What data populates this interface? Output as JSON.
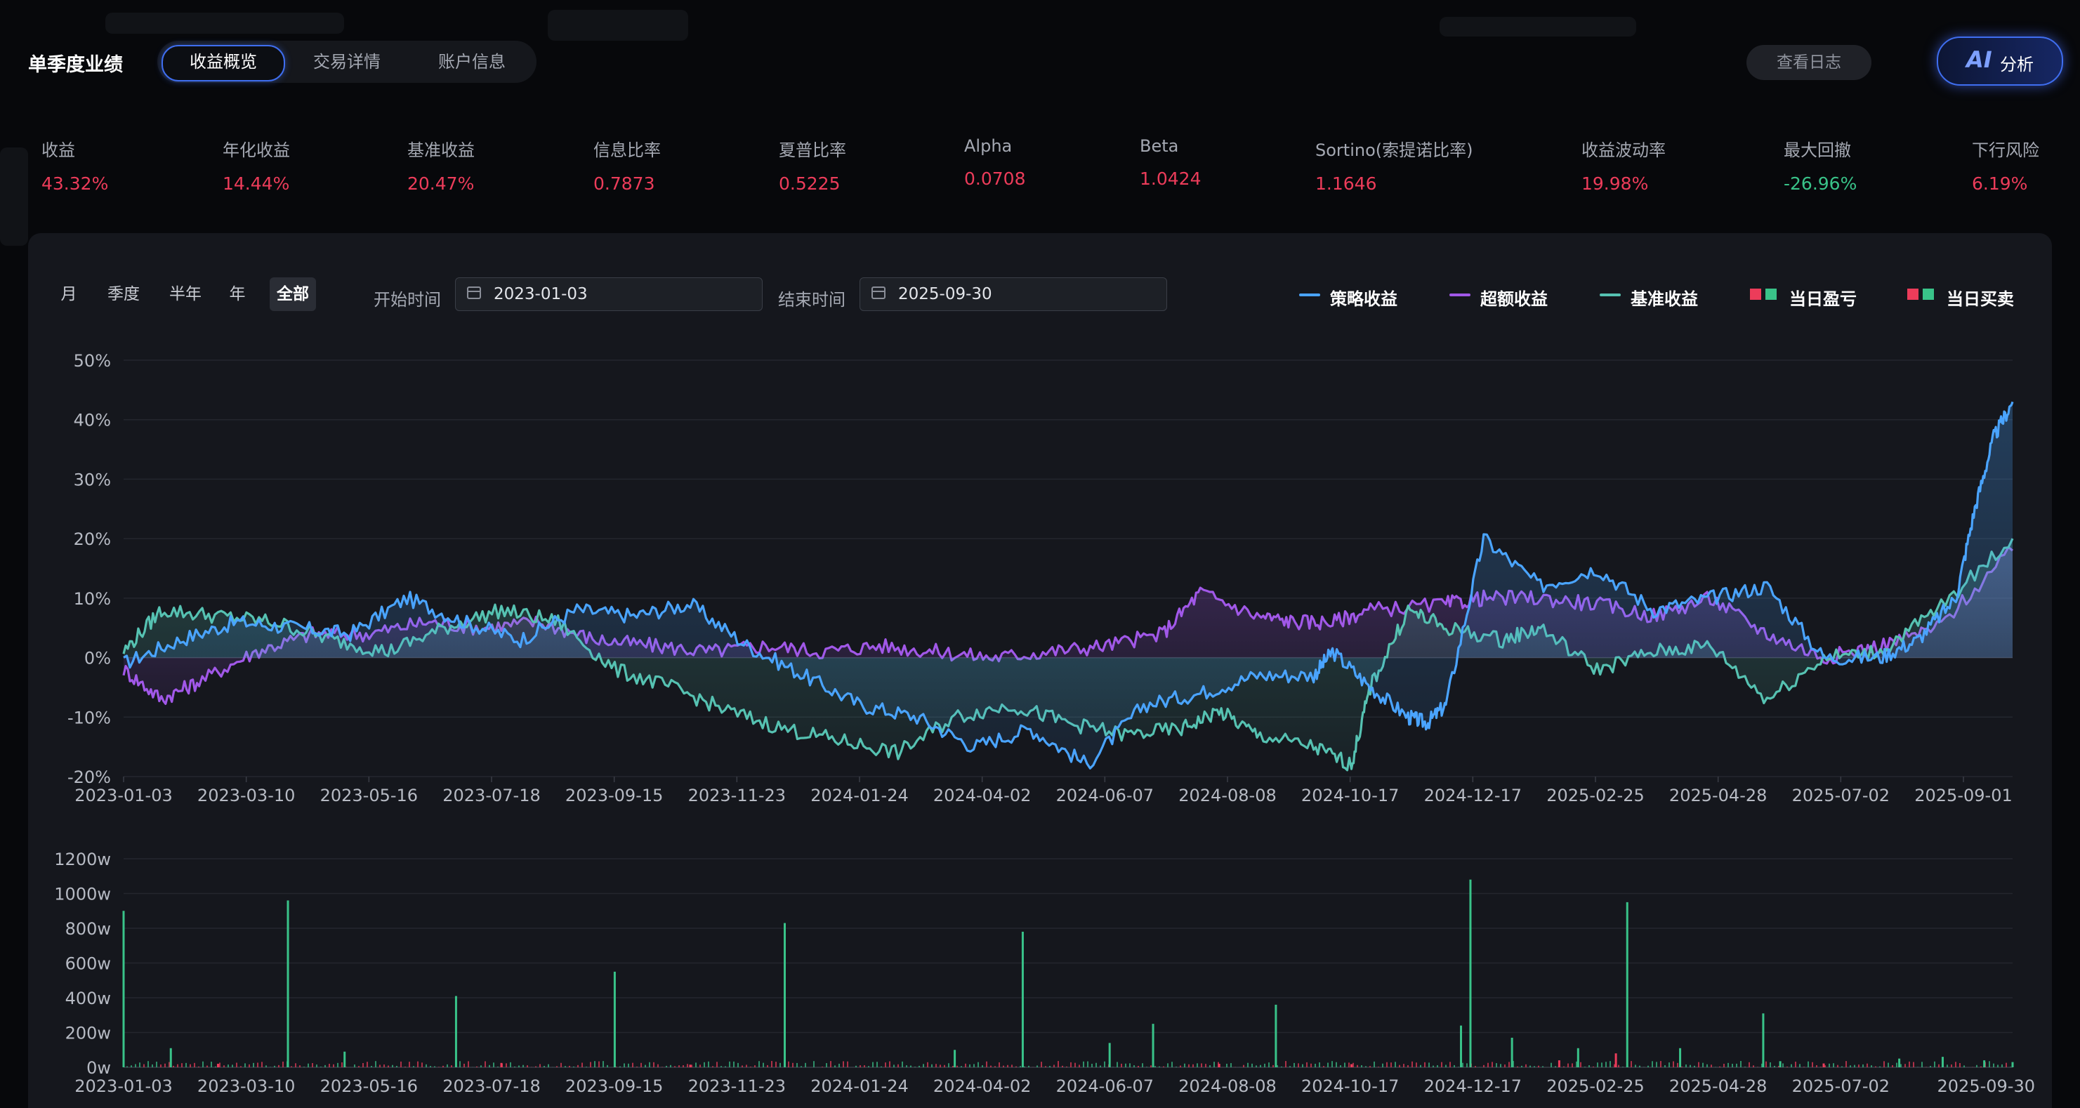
{
  "header": {
    "title": "单季度业绩",
    "tabs": [
      {
        "label": "收益概览",
        "active": true
      },
      {
        "label": "交易详情",
        "active": false
      },
      {
        "label": "账户信息",
        "active": false
      }
    ],
    "log_button": "查看日志",
    "ai_logo": "AI",
    "ai_label": "分析"
  },
  "metrics": [
    {
      "label": "收益",
      "value": "43.32%",
      "tone": "up"
    },
    {
      "label": "年化收益",
      "value": "14.44%",
      "tone": "up"
    },
    {
      "label": "基准收益",
      "value": "20.47%",
      "tone": "up"
    },
    {
      "label": "信息比率",
      "value": "0.7873",
      "tone": "up"
    },
    {
      "label": "夏普比率",
      "value": "0.5225",
      "tone": "up"
    },
    {
      "label": "Alpha",
      "value": "0.0708",
      "tone": "up"
    },
    {
      "label": "Beta",
      "value": "1.0424",
      "tone": "up"
    },
    {
      "label": "Sortino(索提诺比率)",
      "value": "1.1646",
      "tone": "up"
    },
    {
      "label": "收益波动率",
      "value": "19.98%",
      "tone": "up"
    },
    {
      "label": "最大回撤",
      "value": "-26.96%",
      "tone": "down"
    },
    {
      "label": "下行风险",
      "value": "6.19%",
      "tone": "up"
    }
  ],
  "colors": {
    "up": "#ec3c5a",
    "down": "#39c389",
    "strategy": "#4aa4ff",
    "excess": "#a158e8",
    "benchmark": "#56c2b2",
    "accent": "#3f6ef0"
  },
  "controls": {
    "ranges": [
      "月",
      "季度",
      "半年",
      "年",
      "全部"
    ],
    "active_range": "全部",
    "start_label": "开始时间",
    "start_date": "2023-01-03",
    "end_label": "结束时间",
    "end_date": "2025-09-30"
  },
  "legend": [
    {
      "label": "策略收益",
      "kind": "line",
      "color": "#4aa4ff"
    },
    {
      "label": "超额收益",
      "kind": "line",
      "color": "#a158e8"
    },
    {
      "label": "基准收益",
      "kind": "line",
      "color": "#56c2b2"
    },
    {
      "label": "当日盈亏",
      "kind": "squares"
    },
    {
      "label": "当日买卖",
      "kind": "squares"
    }
  ],
  "chart_data": [
    {
      "type": "line",
      "x_ticks": [
        "2023-01-03",
        "2023-03-10",
        "2023-05-16",
        "2023-07-18",
        "2023-09-15",
        "2023-11-23",
        "2024-01-24",
        "2024-04-02",
        "2024-06-07",
        "2024-08-08",
        "2024-10-17",
        "2024-12-17",
        "2025-02-25",
        "2025-04-28",
        "2025-07-02",
        "2025-09-01"
      ],
      "y_ticks": [
        "50%",
        "40%",
        "30%",
        "20%",
        "10%",
        "0%",
        "-10%",
        "-20%"
      ],
      "ylim": [
        -20,
        50
      ],
      "grid": true,
      "area_fill": true,
      "series": [
        {
          "name": "策略收益",
          "color": "#4aa4ff",
          "x": [
            0,
            0.03,
            0.06,
            0.09,
            0.12,
            0.15,
            0.18,
            0.21,
            0.24,
            0.27,
            0.3,
            0.33,
            0.36,
            0.39,
            0.42,
            0.45,
            0.48,
            0.51,
            0.54,
            0.57,
            0.6,
            0.63,
            0.64,
            0.66,
            0.68,
            0.69,
            0.7,
            0.72,
            0.75,
            0.78,
            0.81,
            0.84,
            0.87,
            0.9,
            0.93,
            0.95,
            0.97,
            0.98,
            0.99,
            1.0
          ],
          "y": [
            -1,
            3,
            6,
            5,
            4,
            10,
            6,
            3,
            8,
            7,
            9,
            2,
            -3,
            -8,
            -10,
            -15,
            -12,
            -18,
            -8,
            -6,
            -3,
            -3,
            1,
            -5,
            -10,
            -11,
            -8,
            20,
            12,
            15,
            8,
            10,
            12,
            0,
            0,
            3,
            10,
            25,
            37,
            43
          ]
        },
        {
          "name": "超额收益",
          "color": "#a158e8",
          "x": [
            0,
            0.02,
            0.04,
            0.07,
            0.1,
            0.13,
            0.16,
            0.19,
            0.22,
            0.25,
            0.28,
            0.31,
            0.34,
            0.37,
            0.4,
            0.43,
            0.46,
            0.49,
            0.52,
            0.55,
            0.57,
            0.6,
            0.62,
            0.64,
            0.66,
            0.7,
            0.72,
            0.75,
            0.78,
            0.81,
            0.84,
            0.87,
            0.9,
            0.93,
            0.96,
            1.0
          ],
          "y": [
            -2,
            -7,
            -4,
            1,
            4,
            4,
            6,
            5,
            6,
            3,
            2,
            1,
            2,
            1,
            2,
            1,
            0,
            1,
            2,
            4,
            11,
            7,
            6,
            6,
            8,
            9,
            10,
            10,
            9,
            7,
            10,
            4,
            0,
            2,
            5,
            18
          ]
        },
        {
          "name": "基准收益",
          "color": "#56c2b2",
          "x": [
            0,
            0.02,
            0.05,
            0.08,
            0.11,
            0.14,
            0.17,
            0.2,
            0.23,
            0.26,
            0.29,
            0.32,
            0.35,
            0.38,
            0.41,
            0.44,
            0.47,
            0.5,
            0.53,
            0.56,
            0.58,
            0.6,
            0.63,
            0.65,
            0.66,
            0.68,
            0.7,
            0.73,
            0.75,
            0.78,
            0.81,
            0.84,
            0.87,
            0.9,
            0.93,
            0.96,
            1.0
          ],
          "y": [
            1,
            8,
            7,
            6,
            3,
            1,
            5,
            8,
            6,
            -2,
            -5,
            -9,
            -12,
            -14,
            -16,
            -10,
            -8,
            -11,
            -13,
            -12,
            -9,
            -13,
            -15,
            -18,
            -5,
            8,
            5,
            3,
            5,
            -2,
            1,
            2,
            -7,
            0,
            1,
            8,
            20
          ]
        }
      ]
    },
    {
      "type": "bar",
      "y_ticks": [
        "1200w",
        "1000w",
        "800w",
        "600w",
        "400w",
        "200w",
        "0w"
      ],
      "ylim": [
        0,
        1200
      ],
      "x_ticks": [
        "2023-01-03",
        "2023-03-10",
        "2023-05-16",
        "2023-07-18",
        "2023-09-15",
        "2023-11-23",
        "2024-01-24",
        "2024-04-02",
        "2024-06-07",
        "2024-08-08",
        "2024-10-17",
        "2024-12-17",
        "2025-02-25",
        "2025-04-28",
        "2025-07-02",
        "2025-09-30"
      ],
      "series": [
        {
          "name": "当日买卖",
          "color": "#39c389",
          "x": [
            0.0,
            0.025,
            0.087,
            0.117,
            0.176,
            0.26,
            0.35,
            0.44,
            0.476,
            0.522,
            0.545,
            0.61,
            0.708,
            0.713,
            0.735,
            0.77,
            0.796,
            0.824,
            0.868,
            0.877,
            0.94,
            0.963,
            0.985,
            1.0
          ],
          "values": [
            900,
            110,
            960,
            90,
            410,
            550,
            830,
            100,
            780,
            140,
            250,
            360,
            240,
            1080,
            170,
            110,
            950,
            110,
            310,
            35,
            50,
            60,
            40,
            30
          ]
        },
        {
          "name": "当日盈亏",
          "color": "#ec3c5a",
          "x": [
            0.05,
            0.2,
            0.3,
            0.58,
            0.65,
            0.76,
            0.79,
            0.9
          ],
          "values": [
            20,
            25,
            15,
            20,
            18,
            40,
            80,
            22
          ]
        }
      ]
    }
  ]
}
